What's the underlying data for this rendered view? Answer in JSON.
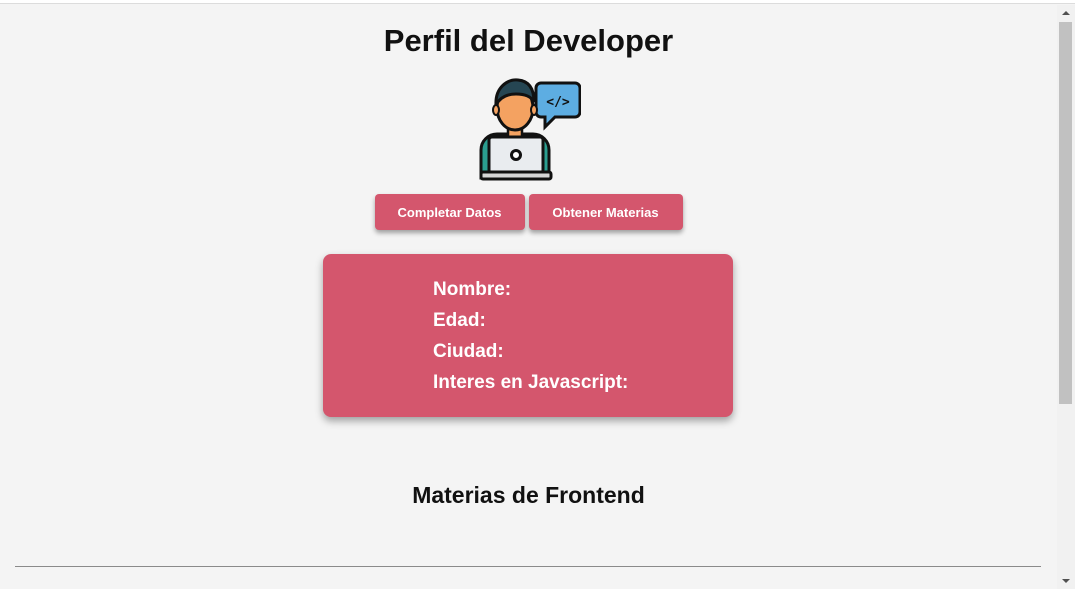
{
  "header": {
    "title": "Perfil del Developer"
  },
  "avatar": {
    "icon": "developer-laptop-icon",
    "bubble_text": "</>"
  },
  "actions": {
    "complete_label": "Completar Datos",
    "subjects_label": "Obtener Materias"
  },
  "profile": {
    "name_label": "Nombre:",
    "age_label": "Edad:",
    "city_label": "Ciudad:",
    "js_interest_label": "Interes en Javascript:"
  },
  "subjects": {
    "title": "Materias de Frontend"
  },
  "colors": {
    "accent": "#d4566d",
    "background": "#f4f4f4",
    "text": "#111111"
  }
}
